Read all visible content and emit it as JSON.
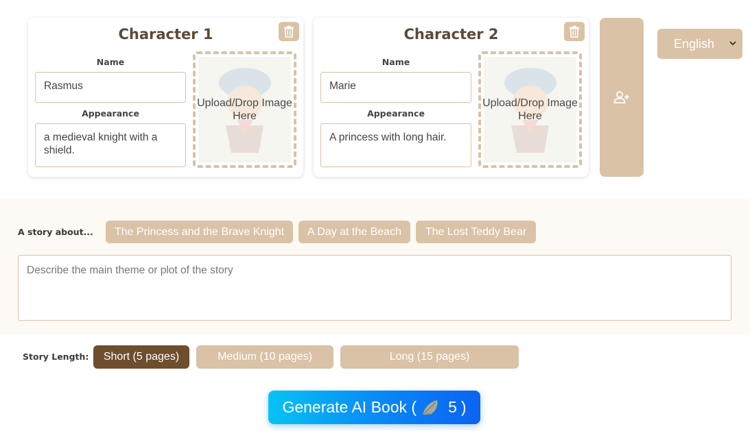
{
  "characters": [
    {
      "title": "Character 1",
      "name_label": "Name",
      "name_value": "Rasmus",
      "appearance_label": "Appearance",
      "appearance_value": "a medieval knight with a shield.",
      "upload_text": "Upload/Drop Image Here"
    },
    {
      "title": "Character 2",
      "name_label": "Name",
      "name_value": "Marie",
      "appearance_label": "Appearance",
      "appearance_value": "A princess with long hair.",
      "upload_text": "Upload/Drop Image Here"
    }
  ],
  "language": {
    "selected": "English"
  },
  "story": {
    "label": "A story about...",
    "suggestions": [
      "The Princess and the Brave Knight",
      "A Day at the Beach",
      "The Lost Teddy Bear"
    ],
    "placeholder": "Describe the main theme or plot of the story"
  },
  "length": {
    "label": "Story Length:",
    "options": [
      "Short (5 pages)",
      "Medium (10 pages)",
      "Long (15 pages)"
    ],
    "selected_index": 0
  },
  "generate": {
    "label_prefix": "Generate AI Book (",
    "credits": "5",
    "label_suffix": ")"
  },
  "icons": {
    "delete": "trash-icon",
    "add_character": "add-user-icon",
    "credit": "feather-icon",
    "dropdown": "chevron-down-icon"
  },
  "colors": {
    "accent": "#d9c2a6",
    "selected": "#6e4e2d",
    "generate_start": "#06c3f4",
    "generate_end": "#0b63f2",
    "panel_bg": "#fdf9f4"
  }
}
